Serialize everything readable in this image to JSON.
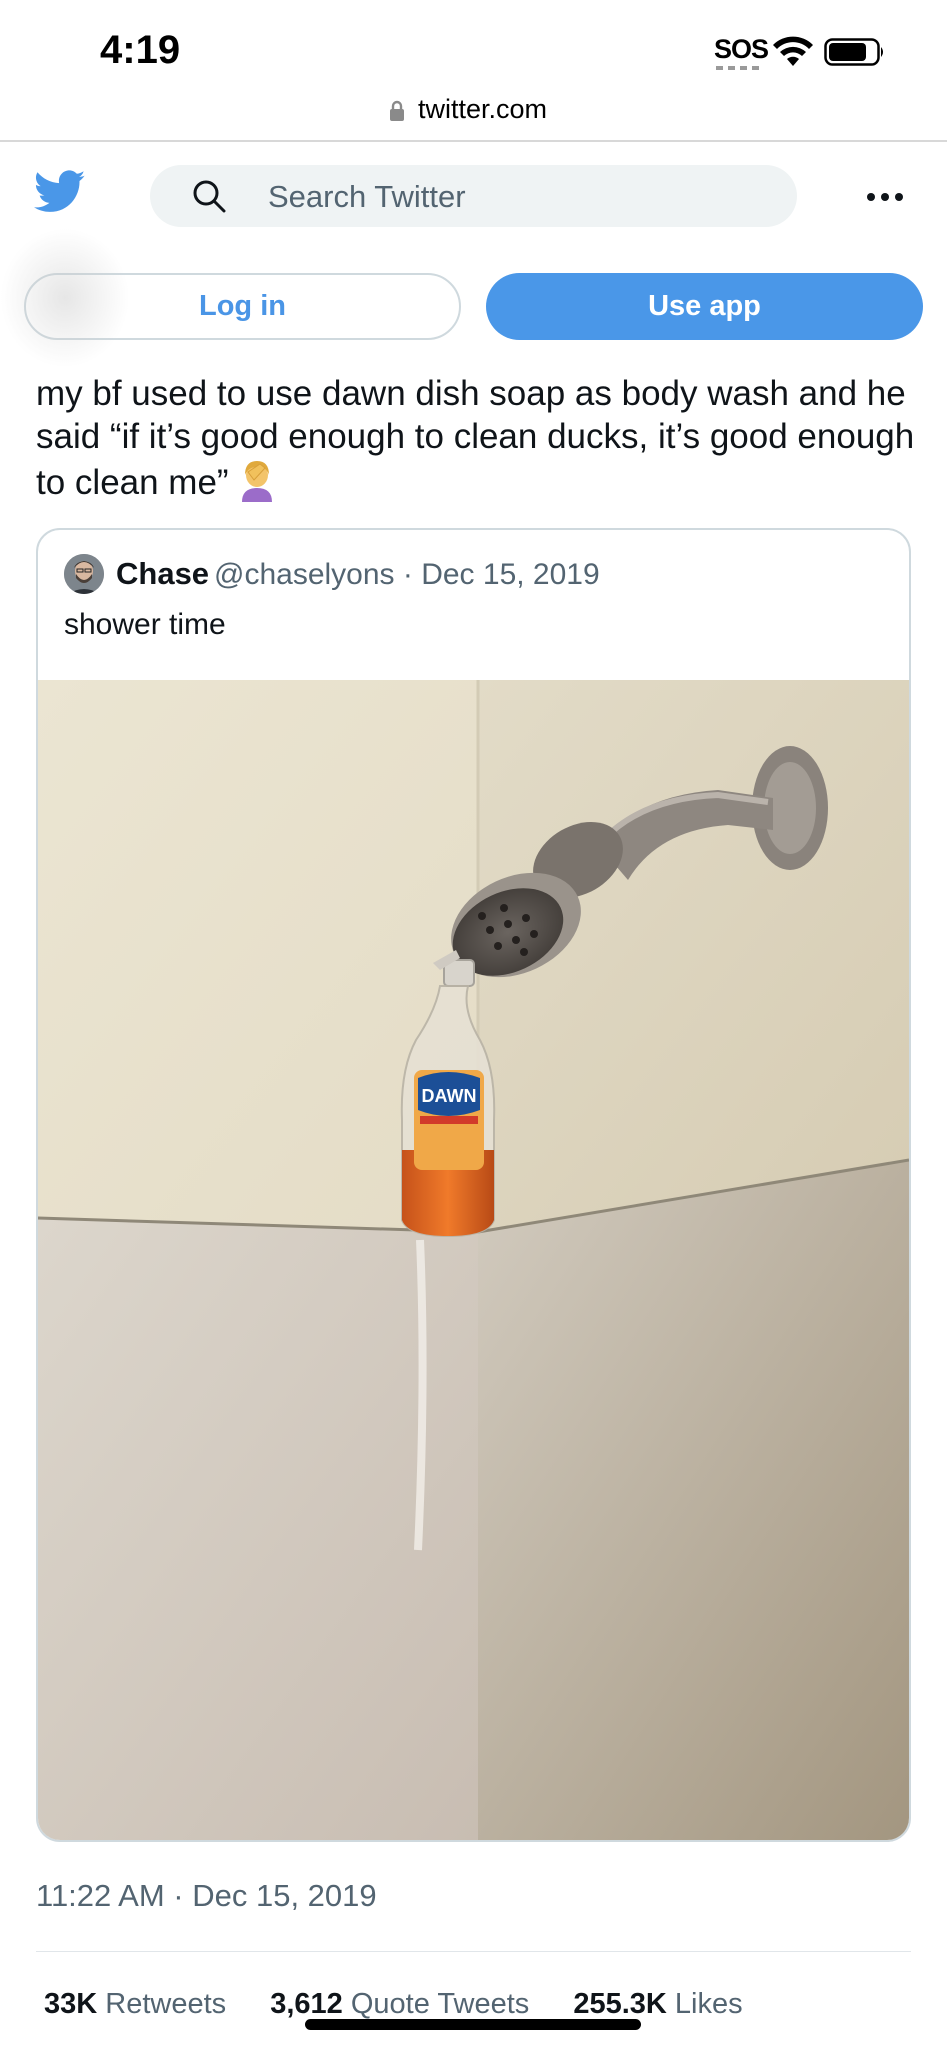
{
  "status_bar": {
    "time": "4:19",
    "sos": "SOS"
  },
  "url_bar": {
    "url": "twitter.com"
  },
  "header": {
    "search_placeholder": "Search Twitter"
  },
  "auth": {
    "login_label": "Log in",
    "use_app_label": "Use app"
  },
  "tweet": {
    "text": "my bf used to use dawn dish soap as body wash and he said “if it’s good enough to clean ducks, it’s good enough to clean me”",
    "timestamp": "11:22 AM · Dec 15, 2019"
  },
  "quote": {
    "name": "Chase",
    "handle_date": "@chaselyons · Dec 15, 2019",
    "text": "shower time",
    "bottle_label": "DAWN"
  },
  "stats": {
    "retweets_count": "33K",
    "retweets_label": "Retweets",
    "quotes_count": "3,612",
    "quotes_label": "Quote Tweets",
    "likes_count": "255.3K",
    "likes_label": "Likes"
  },
  "colors": {
    "twitter_blue": "#4a97e8",
    "secondary_text": "#536471"
  },
  "icons": [
    "lock-icon",
    "wifi-icon",
    "battery-icon",
    "twitter-logo-icon",
    "search-icon",
    "more-icon",
    "facepalm-emoji"
  ]
}
